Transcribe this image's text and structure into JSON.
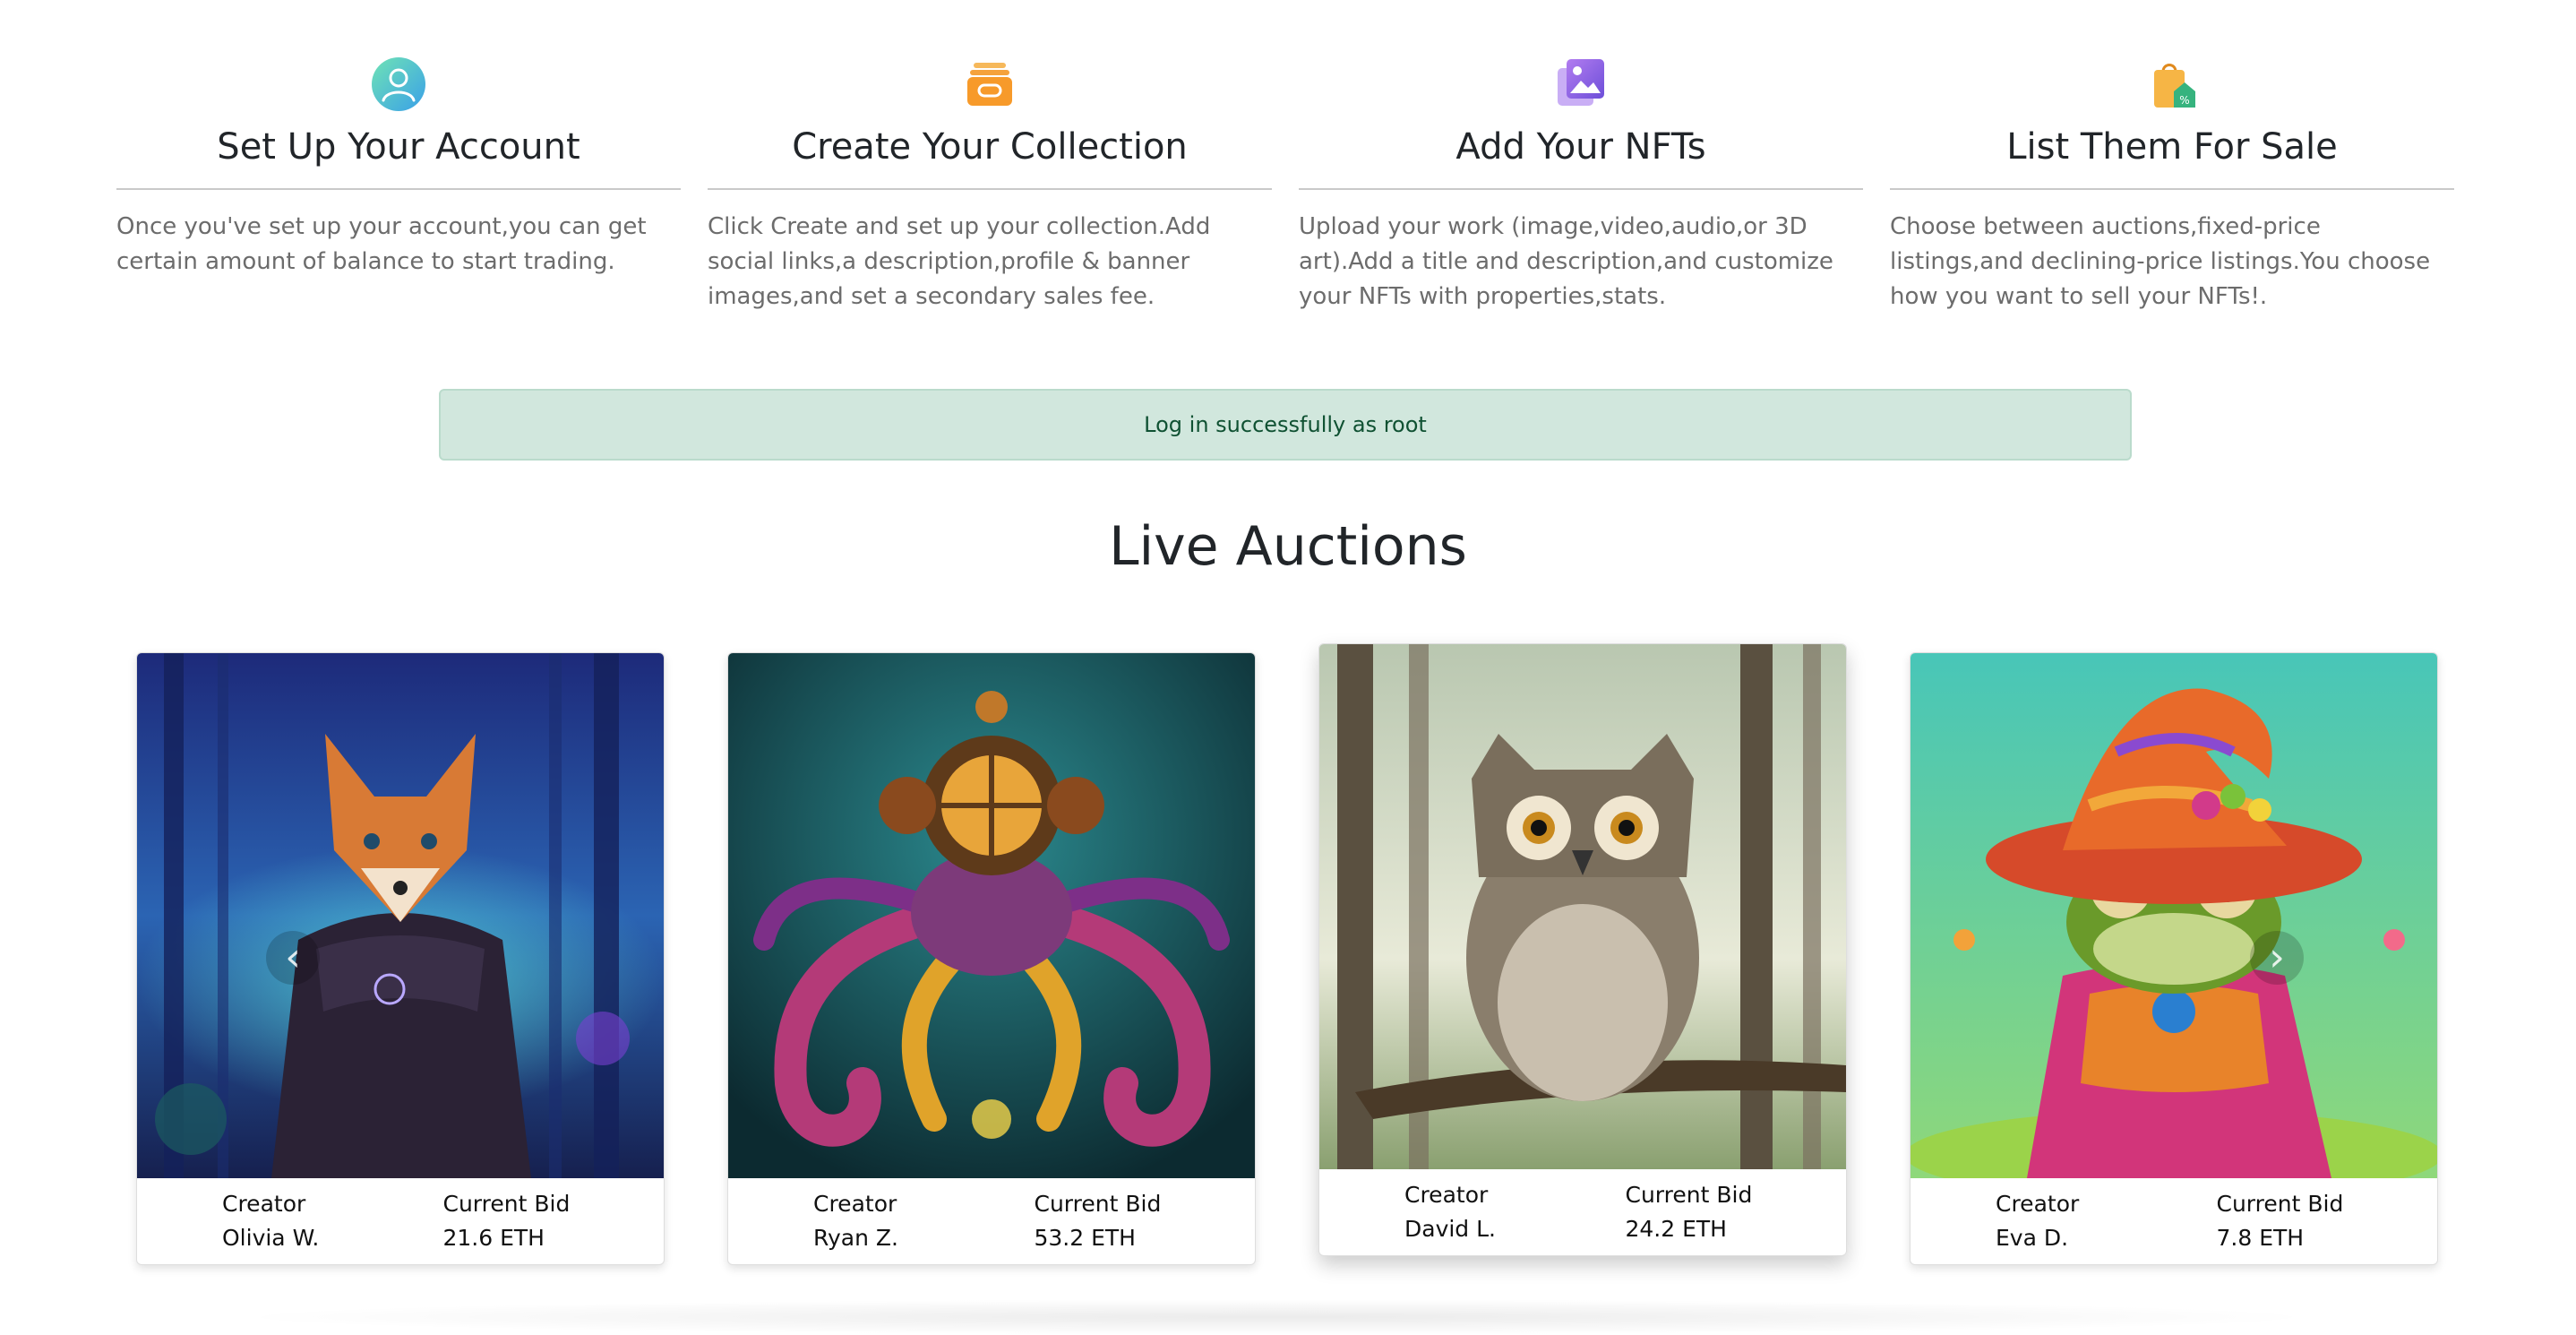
{
  "steps": [
    {
      "icon": "user-icon",
      "title": "Set Up Your Account",
      "text": "Once you've set up your account,you can get certain amount of balance to start trading."
    },
    {
      "icon": "collection-icon",
      "title": "Create Your Collection",
      "text": "Click Create and set up your collection.Add social links,a description,profile & banner images,and set a secondary sales fee."
    },
    {
      "icon": "image-gallery-icon",
      "title": "Add Your NFTs",
      "text": "Upload your work (image,video,audio,or 3D art).Add a title and description,and customize your NFTs with properties,stats."
    },
    {
      "icon": "shopping-bag-icon",
      "title": "List Them For Sale",
      "text": "Choose between auctions,fixed-price listings,and declining-price listings.You choose how you want to sell your NFTs!."
    }
  ],
  "alert": {
    "message": "Log in successfully as root"
  },
  "auctions": {
    "title": "Live Auctions",
    "creator_label": "Creator",
    "bid_label": "Current Bid",
    "prev_icon": "chevron-left-icon",
    "next_icon": "chevron-right-icon",
    "items": [
      {
        "image": "fox-in-cloak-artwork",
        "creator": "Olivia W.",
        "bid": "21.6 ETH"
      },
      {
        "image": "psychedelic-octopus-artwork",
        "creator": "Ryan Z.",
        "bid": "53.2 ETH"
      },
      {
        "image": "owl-on-branch-artwork",
        "creator": "David L.",
        "bid": "24.2 ETH"
      },
      {
        "image": "frog-wizard-artwork",
        "creator": "Eva D.",
        "bid": "7.8 ETH"
      }
    ]
  },
  "colors": {
    "alert_bg": "#d1e7dd",
    "alert_text": "#0f5132",
    "body_text": "#6c6c6c"
  }
}
